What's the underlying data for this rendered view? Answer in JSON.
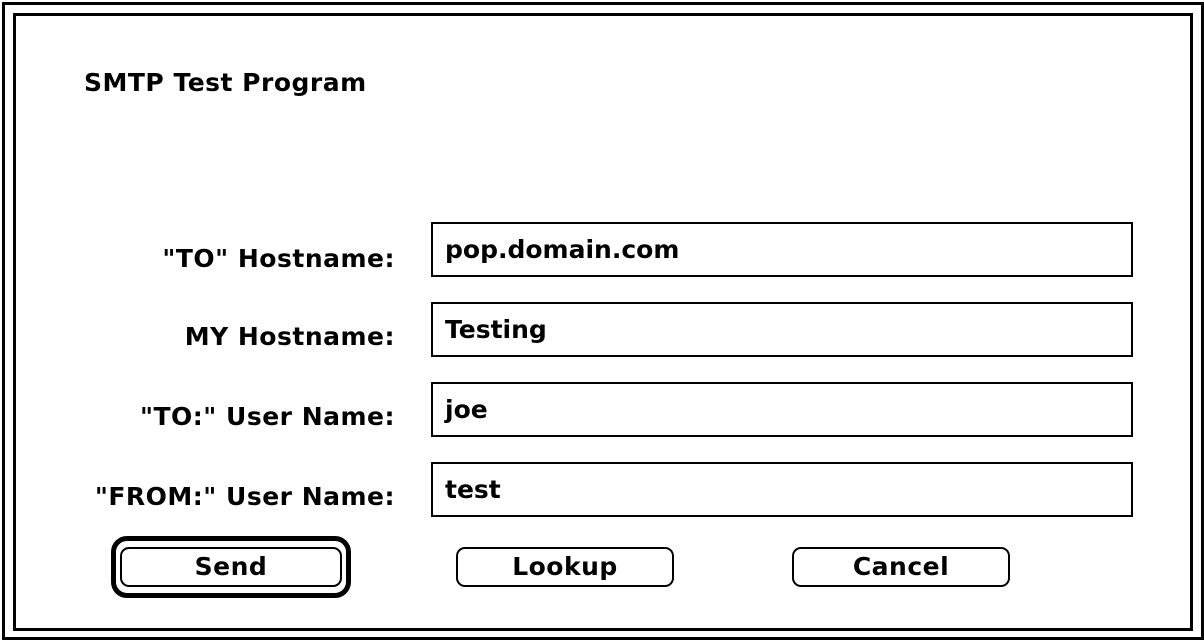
{
  "dialog": {
    "title": "SMTP Test Program"
  },
  "fields": [
    {
      "label": "\"TO\" Hostname:",
      "value": "pop.domain.com"
    },
    {
      "label": "MY Hostname:",
      "value": "Testing"
    },
    {
      "label": "\"TO:\" User Name:",
      "value": "joe"
    },
    {
      "label": "\"FROM:\" User Name:",
      "value": "test"
    }
  ],
  "buttons": {
    "send": "Send",
    "lookup": "Lookup",
    "cancel": "Cancel"
  }
}
